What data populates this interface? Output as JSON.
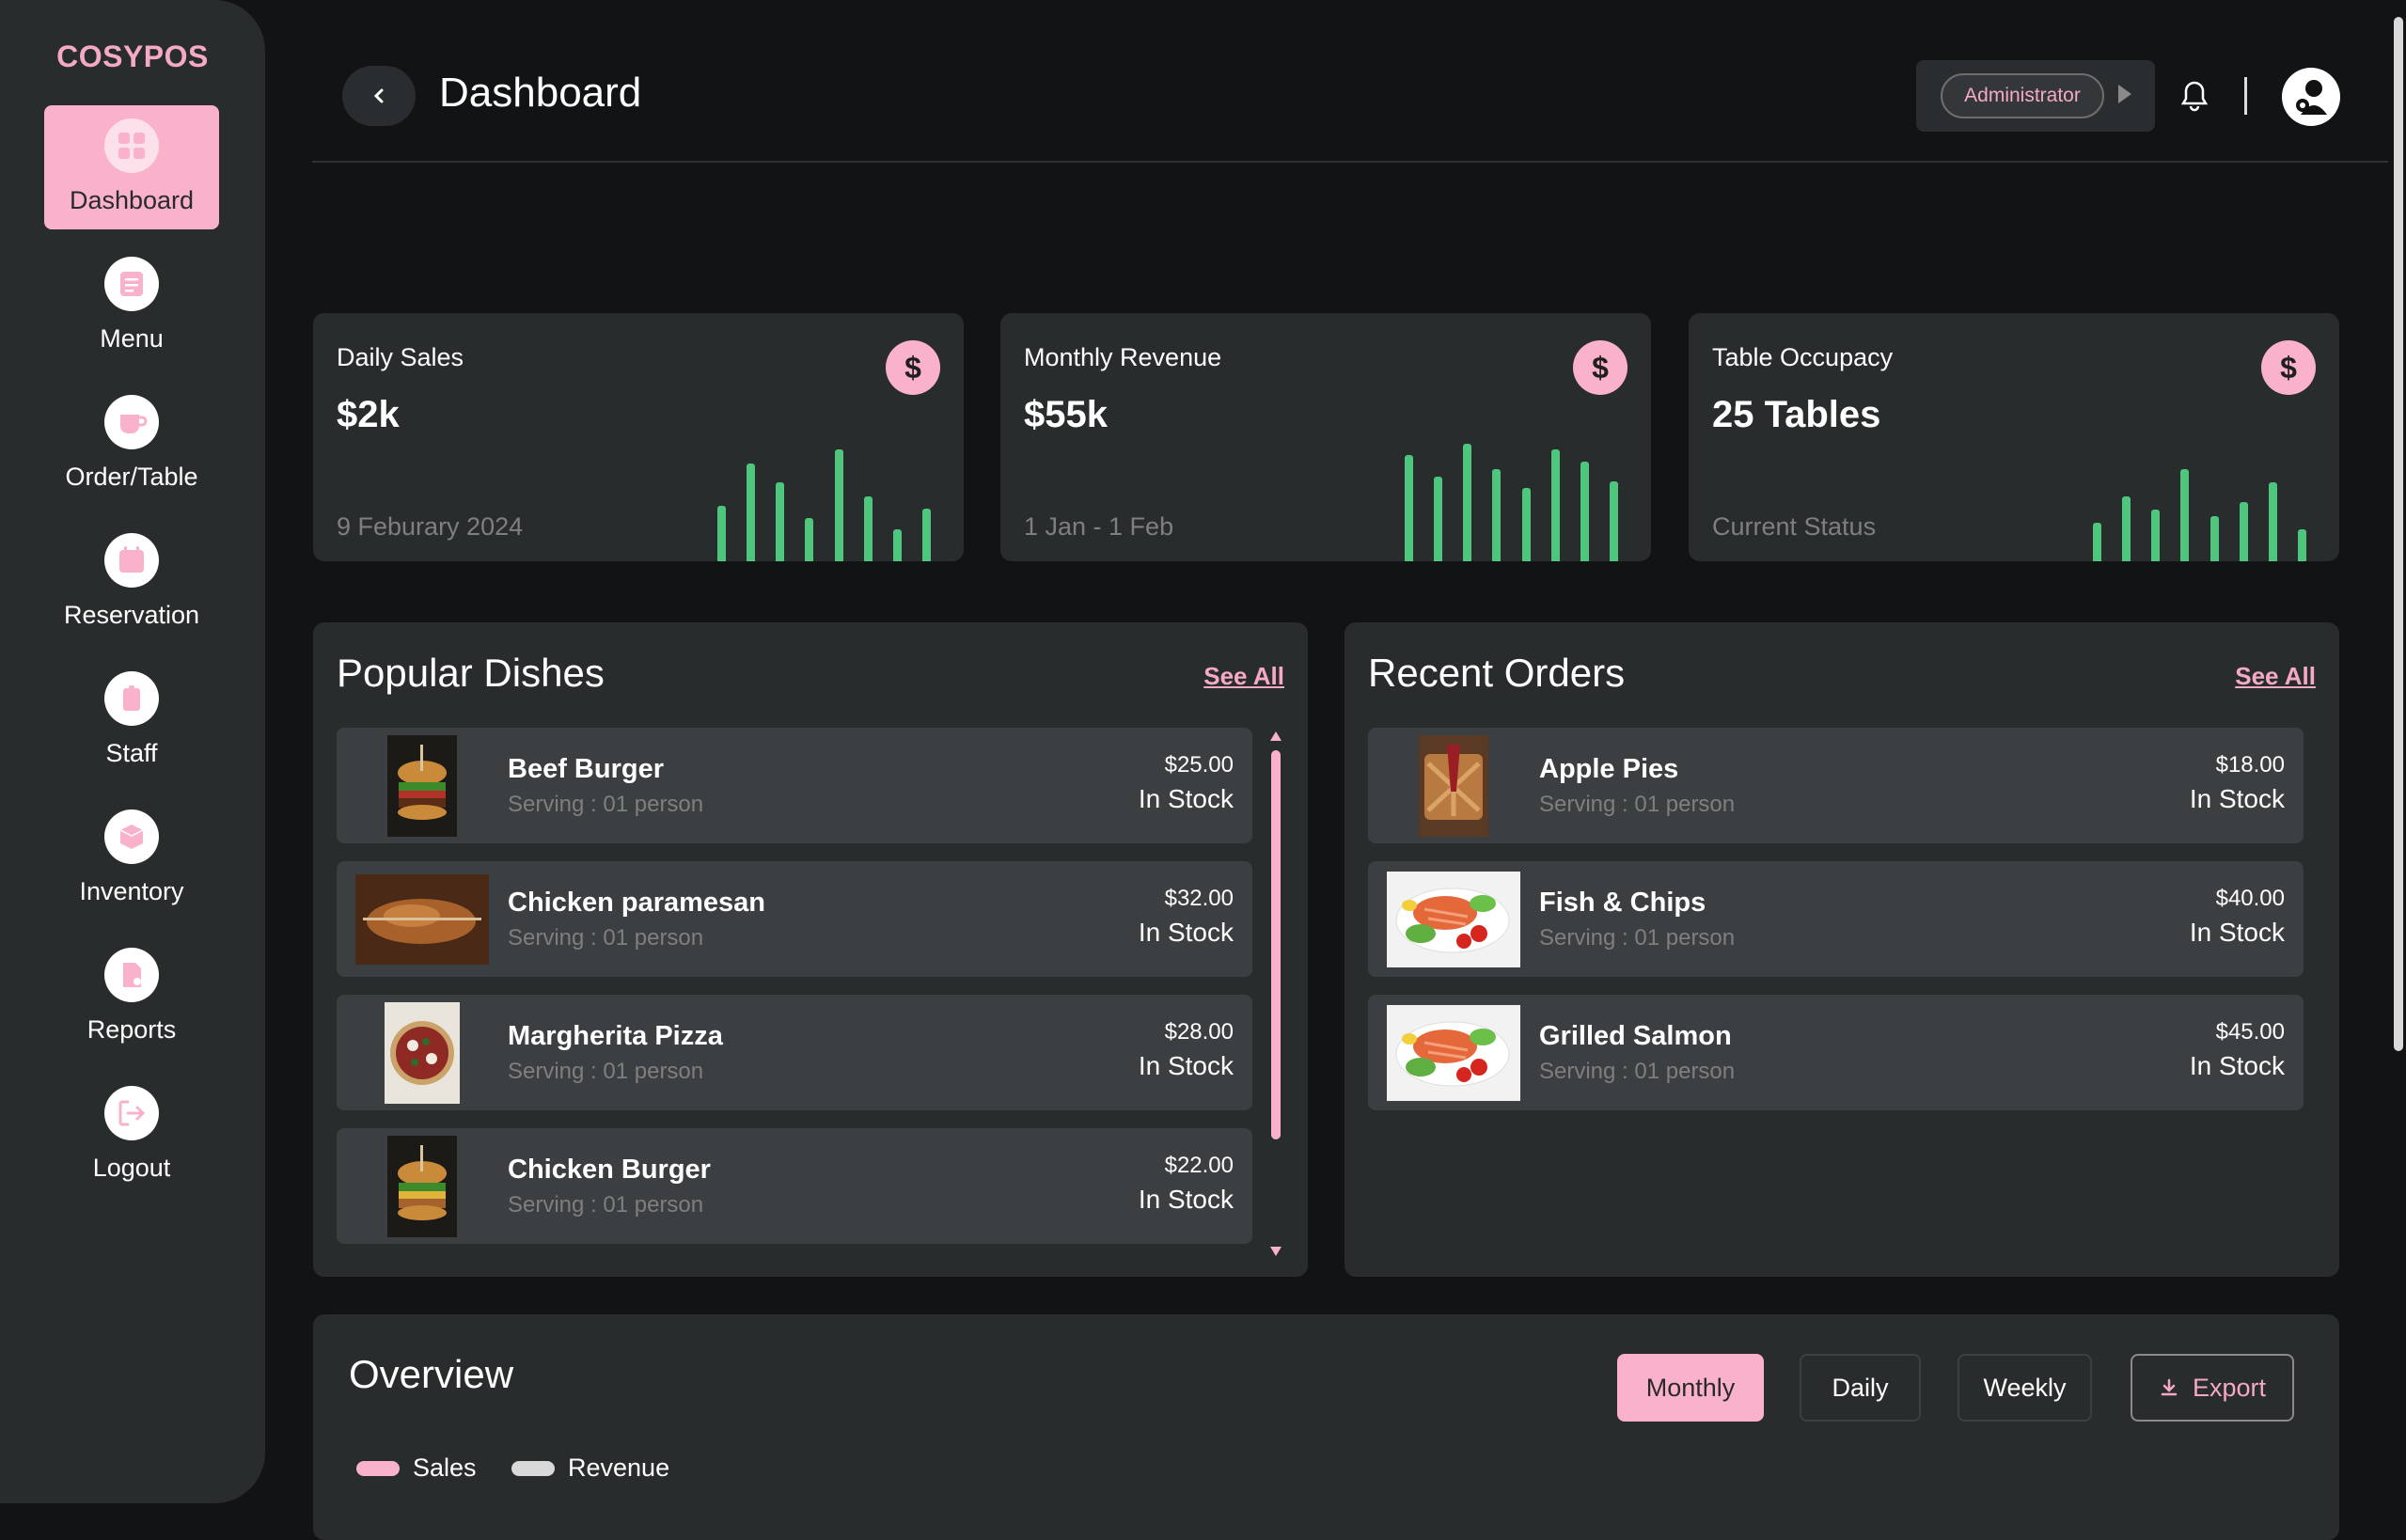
{
  "app": {
    "logo": "COSYPOS"
  },
  "sidebar": {
    "items": [
      {
        "label": "Dashboard",
        "icon": "grid-icon"
      },
      {
        "label": "Menu",
        "icon": "menu-icon"
      },
      {
        "label": "Order/Table",
        "icon": "cup-icon"
      },
      {
        "label": "Reservation",
        "icon": "calendar-icon"
      },
      {
        "label": "Staff",
        "icon": "staff-icon"
      },
      {
        "label": "Inventory",
        "icon": "box-icon"
      },
      {
        "label": "Reports",
        "icon": "report-icon"
      },
      {
        "label": "Logout",
        "icon": "logout-icon"
      }
    ]
  },
  "header": {
    "title": "Dashboard",
    "role": "Administrator"
  },
  "stats": [
    {
      "title": "Daily Sales",
      "value": "$2k",
      "sub": "9 Feburary 2024",
      "icon": "$",
      "bars": [
        0.47,
        0.83,
        0.67,
        0.37,
        0.95,
        0.55,
        0.27,
        0.45
      ]
    },
    {
      "title": "Monthly Revenue",
      "value": "$55k",
      "sub": "1 Jan - 1 Feb",
      "icon": "$",
      "bars": [
        0.9,
        0.72,
        1.0,
        0.78,
        0.62,
        0.95,
        0.85,
        0.68
      ]
    },
    {
      "title": "Table Occupacy",
      "value": "25 Tables",
      "sub": "Current Status",
      "icon": "$",
      "bars": [
        0.33,
        0.55,
        0.44,
        0.78,
        0.38,
        0.5,
        0.67,
        0.27
      ]
    }
  ],
  "popular": {
    "title": "Popular Dishes",
    "see_all": "See All",
    "items": [
      {
        "name": "Beef Burger",
        "serving": "Serving : 01 person",
        "price": "$25.00",
        "stock": "In Stock",
        "image": "burger"
      },
      {
        "name": "Chicken paramesan",
        "serving": "Serving : 01 person",
        "price": "$32.00",
        "stock": "In Stock",
        "image": "chicken"
      },
      {
        "name": "Margherita Pizza",
        "serving": "Serving : 01 person",
        "price": "$28.00",
        "stock": "In Stock",
        "image": "pizza"
      },
      {
        "name": "Chicken Burger",
        "serving": "Serving : 01 person",
        "price": "$22.00",
        "stock": "In Stock",
        "image": "burger"
      }
    ]
  },
  "recent": {
    "title": "Recent Orders",
    "see_all": "See All",
    "items": [
      {
        "name": "Apple Pies",
        "serving": "Serving : 01 person",
        "price": "$18.00",
        "stock": "In Stock",
        "image": "pie"
      },
      {
        "name": "Fish & Chips",
        "serving": "Serving : 01 person",
        "price": "$40.00",
        "stock": "In Stock",
        "image": "salmon"
      },
      {
        "name": "Grilled Salmon",
        "serving": "Serving : 01 person",
        "price": "$45.00",
        "stock": "In Stock",
        "image": "salmon"
      }
    ]
  },
  "overview": {
    "title": "Overview",
    "buttons": {
      "monthly": "Monthly",
      "daily": "Daily",
      "weekly": "Weekly",
      "export": "Export"
    },
    "legend": [
      {
        "label": "Sales",
        "color": "#fab2cc"
      },
      {
        "label": "Revenue",
        "color": "#d9d9d9"
      }
    ]
  },
  "colors": {
    "accent": "#fab2cc",
    "bar": "#4ec67e",
    "panel": "#292c2d",
    "background": "#111315"
  }
}
